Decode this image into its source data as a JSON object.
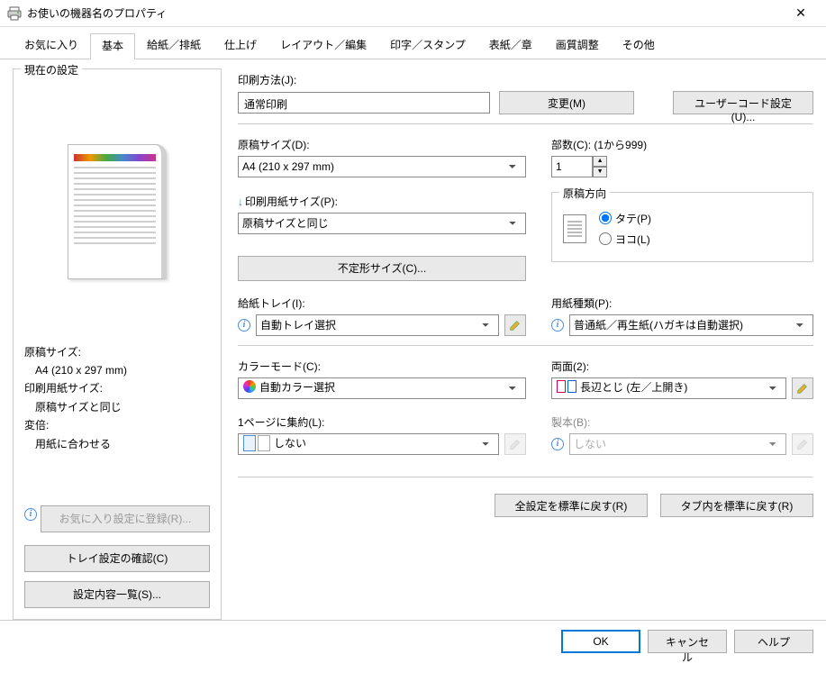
{
  "window": {
    "title": "お使いの機器名のプロパティ"
  },
  "tabs": {
    "items": [
      {
        "label": "お気に入り"
      },
      {
        "label": "基本"
      },
      {
        "label": "給紙／排紙"
      },
      {
        "label": "仕上げ"
      },
      {
        "label": "レイアウト／編集"
      },
      {
        "label": "印字／スタンプ"
      },
      {
        "label": "表紙／章"
      },
      {
        "label": "画質調整"
      },
      {
        "label": "その他"
      }
    ],
    "active_index": 1
  },
  "left": {
    "frame_title": "現在の設定",
    "info": {
      "doc_size_label": "原稿サイズ:",
      "doc_size_value": "A4 (210 x 297 mm)",
      "print_size_label": "印刷用紙サイズ:",
      "print_size_value": "原稿サイズと同じ",
      "zoom_label": "変倍:",
      "zoom_value": "用紙に合わせる"
    },
    "fav_btn": "お気に入り設定に登録(R)...",
    "tray_btn": "トレイ設定の確認(C)",
    "summary_btn": "設定内容一覧(S)..."
  },
  "right": {
    "print_method_label": "印刷方法(J):",
    "print_method_value": "通常印刷",
    "change_btn": "変更(M)",
    "user_code_btn": "ユーザーコード設定(U)...",
    "doc_size_label": "原稿サイズ(D):",
    "doc_size_value": "A4 (210 x 297 mm)",
    "copies_label": "部数(C): (1から999)",
    "copies_value": "1",
    "print_paper_size_label": "印刷用紙サイズ(P):",
    "print_paper_size_value": "原稿サイズと同じ",
    "orientation_title": "原稿方向",
    "orient_portrait": "タテ(P)",
    "orient_landscape": "ヨコ(L)",
    "custom_size_btn": "不定形サイズ(C)...",
    "tray_label": "給紙トレイ(I):",
    "tray_value": "自動トレイ選択",
    "paper_type_label": "用紙種類(P):",
    "paper_type_value": "普通紙／再生紙(ハガキは自動選択)",
    "color_mode_label": "カラーモード(C):",
    "color_mode_value": "自動カラー選択",
    "duplex_label": "両面(2):",
    "duplex_value": "長辺とじ (左／上開き)",
    "nup_label": "1ページに集約(L):",
    "nup_value": "しない",
    "booklet_label": "製本(B):",
    "booklet_value": "しない",
    "restore_all_btn": "全設定を標準に戻す(R)",
    "restore_tab_btn": "タブ内を標準に戻す(R)"
  },
  "footer": {
    "ok": "OK",
    "cancel": "キャンセル",
    "help": "ヘルプ"
  }
}
